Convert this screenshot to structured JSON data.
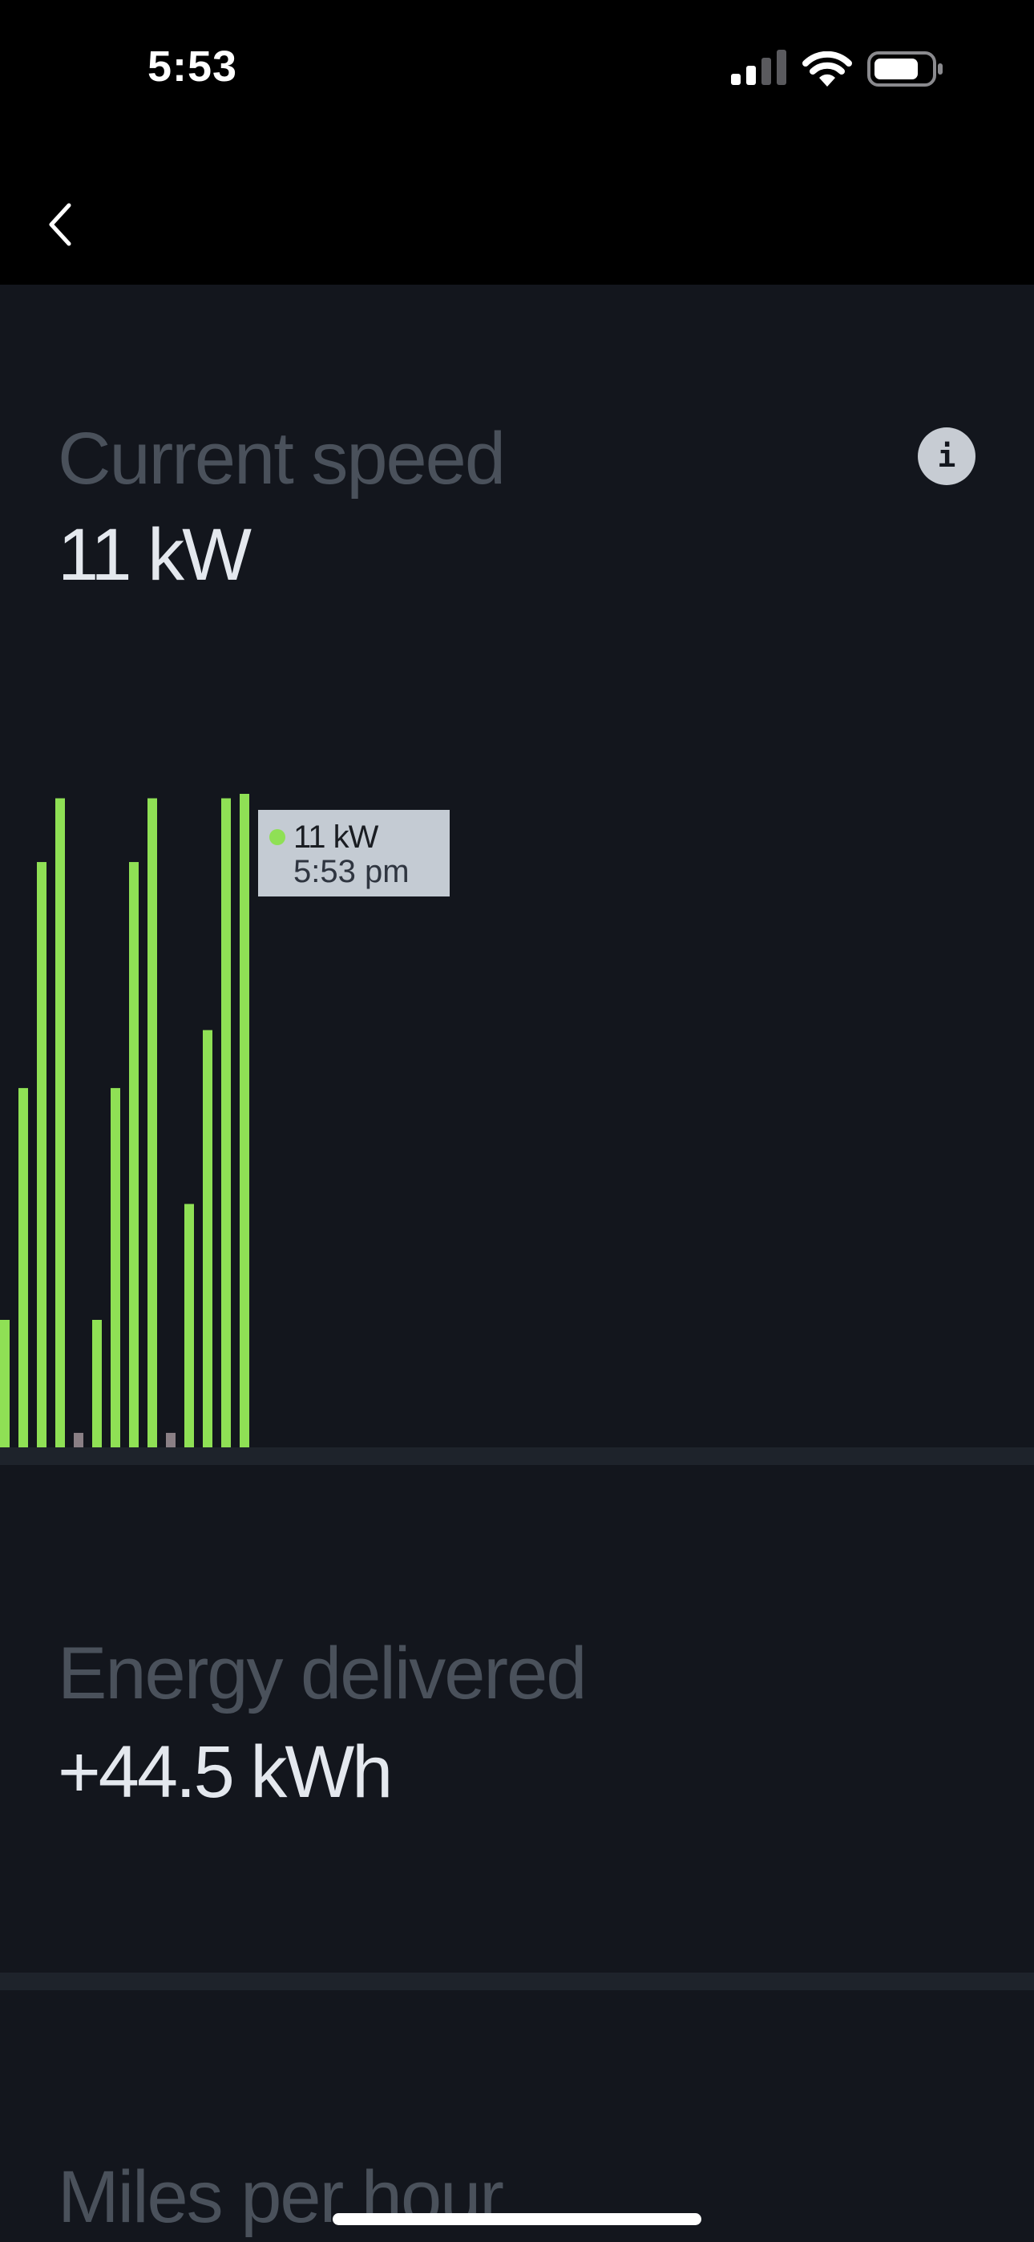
{
  "status_bar": {
    "time": "5:53",
    "icons": [
      "cellular-signal-icon",
      "wifi-icon",
      "battery-icon"
    ]
  },
  "nav": {
    "back_icon": "chevron-left-icon"
  },
  "current_speed": {
    "label": "Current speed",
    "value": "11 kW",
    "info_glyph": "i"
  },
  "tooltip": {
    "value": "11 kW",
    "time": "5:53 pm",
    "dot_color": "#8fe055"
  },
  "energy_delivered": {
    "label": "Energy delivered",
    "value": "+44.5 kWh"
  },
  "miles_per_hour": {
    "label": "Miles per hour"
  },
  "chart_data": {
    "type": "bar",
    "unit": "kW",
    "ylim": [
      0,
      11
    ],
    "grid": false,
    "values": [
      2.2,
      6.2,
      10.1,
      11.2,
      0.25,
      2.2,
      6.2,
      10.1,
      11.2,
      0.25,
      4.2,
      7.2,
      11.2,
      11.5
    ],
    "colors": {
      "charging": "#8fe055",
      "idle": "#8a7f85"
    },
    "highlight": {
      "value": 11,
      "time": "5:53 pm"
    }
  }
}
